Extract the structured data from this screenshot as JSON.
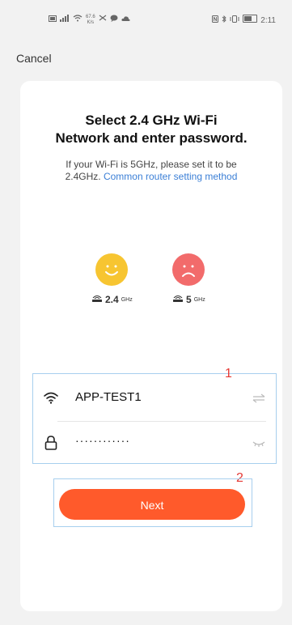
{
  "status_bar": {
    "left_icons": [
      "sim-icon",
      "signal-icon",
      "wifi-icon",
      "data-speed-icon",
      "mute-icon",
      "chat-icon",
      "cloud-icon"
    ],
    "speed_value": "67.6",
    "speed_unit": "K/s",
    "right_icons": [
      "nfc-icon",
      "bluetooth-icon",
      "vibrate-icon",
      "battery-icon"
    ],
    "time": "2:11"
  },
  "nav": {
    "cancel_label": "Cancel"
  },
  "header": {
    "title_line1": "Select 2.4 GHz Wi-Fi",
    "title_line2": "Network and enter password.",
    "subtitle_line1": "If your Wi-Fi is 5GHz, please set it to be",
    "subtitle_prefix": "2.4GHz.",
    "subtitle_link": "Common router setting method"
  },
  "bands": [
    {
      "num": "2.4",
      "unit": "GHz",
      "mood": "happy",
      "color": "#f7c531"
    },
    {
      "num": "5",
      "unit": "GHz",
      "mood": "sad",
      "color": "#f26b6b"
    }
  ],
  "form": {
    "ssid_value": "APP-TEST1",
    "password_value": "············"
  },
  "annotations": {
    "marker1": "1",
    "marker2": "2"
  },
  "actions": {
    "next_label": "Next"
  },
  "colors": {
    "accent": "#ff5a2b",
    "link": "#3b7fd6",
    "annotation_box": "#a7cfee",
    "annotation_text": "#e53935"
  }
}
